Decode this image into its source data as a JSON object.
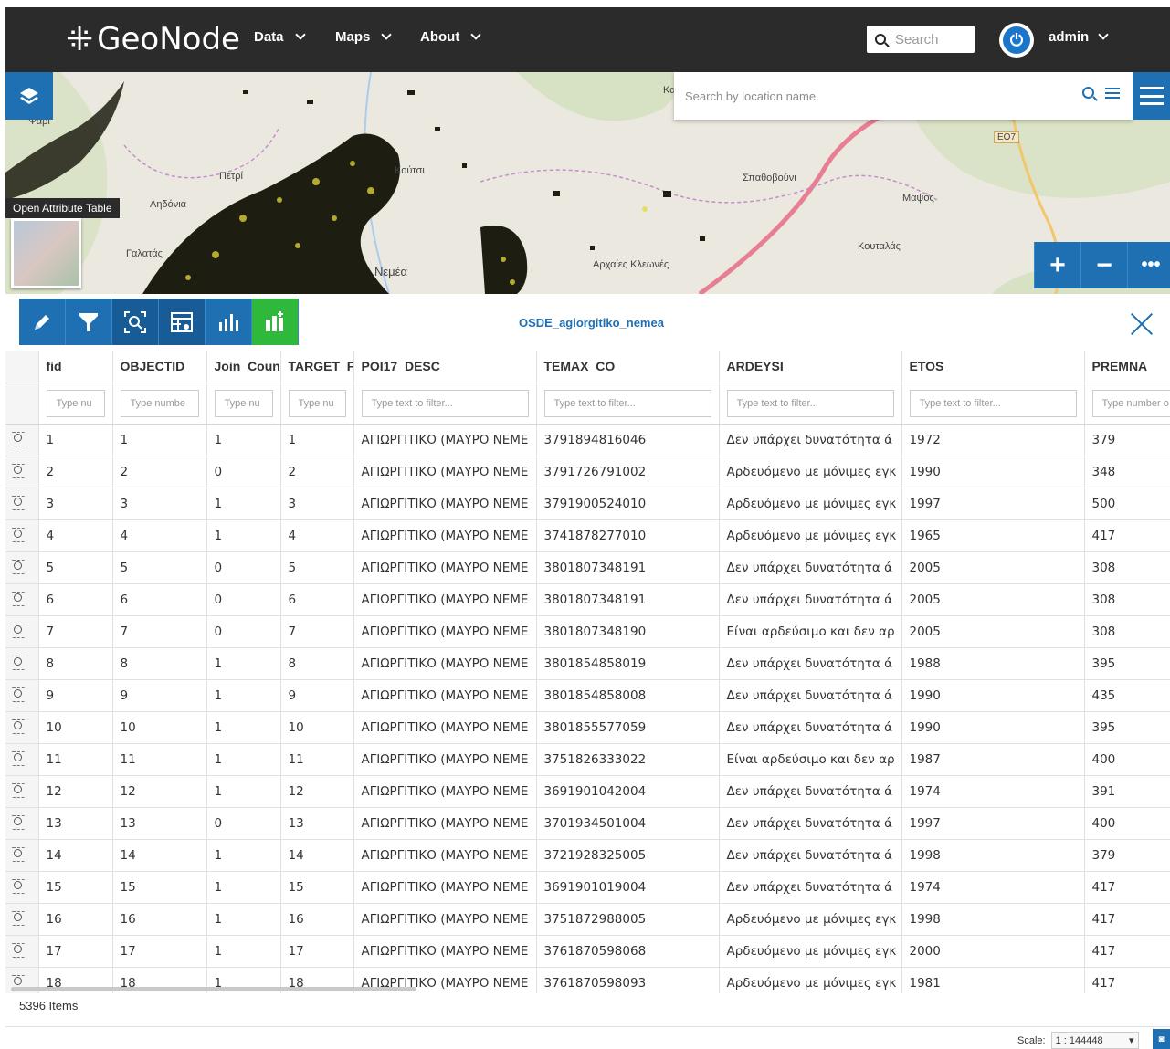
{
  "header": {
    "brand": "GeoNode",
    "nav": [
      "Data",
      "Maps",
      "About"
    ],
    "search_placeholder": "Search",
    "user": "admin"
  },
  "map": {
    "location_placeholder": "Search by location name",
    "tooltip": "Open Attribute Table",
    "labels": [
      "Ψάρι",
      "Αηδόνια",
      "Πετρί",
      "Κούτσι",
      "Γαλατάς",
      "Νεμέα",
      "Αρχαίες Κλεωνές",
      "Σπαθοβούνι",
      "Μαψός",
      "Κουταλάς",
      "ΕΟ7",
      "Κα"
    ]
  },
  "attribute_table": {
    "title": "OSDE_agiorgitiko_nemea",
    "columns": [
      "fid",
      "OBJECTID",
      "Join_Count",
      "TARGET_FI",
      "POI17_DESC",
      "TEMAX_CO",
      "ARDEYSI",
      "ETOS",
      "PREMNA"
    ],
    "filter_placeholders": [
      "Type nu",
      "Type numbe",
      "Type nu",
      "Type nu",
      "Type text to filter...",
      "Type text to filter...",
      "Type text to filter...",
      "Type text to filter...",
      "Type number o"
    ],
    "rows": [
      [
        "1",
        "1",
        "1",
        "1",
        "ΑΓΙΩΡΓΙΤΙΚΟ (ΜΑΥΡΟ ΝΕΜΕ",
        "3791894816046",
        "Δεν υπάρχει δυνατότητα ά",
        "1972",
        "379"
      ],
      [
        "2",
        "2",
        "0",
        "2",
        "ΑΓΙΩΡΓΙΤΙΚΟ (ΜΑΥΡΟ ΝΕΜΕ",
        "3791726791002",
        "Αρδευόμενο με μόνιμες εγκ",
        "1990",
        "348"
      ],
      [
        "3",
        "3",
        "1",
        "3",
        "ΑΓΙΩΡΓΙΤΙΚΟ (ΜΑΥΡΟ ΝΕΜΕ",
        "3791900524010",
        "Αρδευόμενο με μόνιμες εγκ",
        "1997",
        "500"
      ],
      [
        "4",
        "4",
        "1",
        "4",
        "ΑΓΙΩΡΓΙΤΙΚΟ (ΜΑΥΡΟ ΝΕΜΕ",
        "3741878277010",
        "Αρδευόμενο με μόνιμες εγκ",
        "1965",
        "417"
      ],
      [
        "5",
        "5",
        "0",
        "5",
        "ΑΓΙΩΡΓΙΤΙΚΟ (ΜΑΥΡΟ ΝΕΜΕ",
        "3801807348191",
        "Δεν υπάρχει δυνατότητα ά",
        "2005",
        "308"
      ],
      [
        "6",
        "6",
        "0",
        "6",
        "ΑΓΙΩΡΓΙΤΙΚΟ (ΜΑΥΡΟ ΝΕΜΕ",
        "3801807348191",
        "Δεν υπάρχει δυνατότητα ά",
        "2005",
        "308"
      ],
      [
        "7",
        "7",
        "0",
        "7",
        "ΑΓΙΩΡΓΙΤΙΚΟ (ΜΑΥΡΟ ΝΕΜΕ",
        "3801807348190",
        "Είναι αρδεύσιμο και δεν αρ",
        "2005",
        "308"
      ],
      [
        "8",
        "8",
        "1",
        "8",
        "ΑΓΙΩΡΓΙΤΙΚΟ (ΜΑΥΡΟ ΝΕΜΕ",
        "3801854858019",
        "Δεν υπάρχει δυνατότητα ά",
        "1988",
        "395"
      ],
      [
        "9",
        "9",
        "1",
        "9",
        "ΑΓΙΩΡΓΙΤΙΚΟ (ΜΑΥΡΟ ΝΕΜΕ",
        "3801854858008",
        "Δεν υπάρχει δυνατότητα ά",
        "1990",
        "435"
      ],
      [
        "10",
        "10",
        "1",
        "10",
        "ΑΓΙΩΡΓΙΤΙΚΟ (ΜΑΥΡΟ ΝΕΜΕ",
        "3801855577059",
        "Δεν υπάρχει δυνατότητα ά",
        "1990",
        "395"
      ],
      [
        "11",
        "11",
        "1",
        "11",
        "ΑΓΙΩΡΓΙΤΙΚΟ (ΜΑΥΡΟ ΝΕΜΕ",
        "3751826333022",
        "Είναι αρδεύσιμο και δεν αρ",
        "1987",
        "400"
      ],
      [
        "12",
        "12",
        "1",
        "12",
        "ΑΓΙΩΡΓΙΤΙΚΟ (ΜΑΥΡΟ ΝΕΜΕ",
        "3691901042004",
        "Δεν υπάρχει δυνατότητα ά",
        "1974",
        "391"
      ],
      [
        "13",
        "13",
        "0",
        "13",
        "ΑΓΙΩΡΓΙΤΙΚΟ (ΜΑΥΡΟ ΝΕΜΕ",
        "3701934501004",
        "Δεν υπάρχει δυνατότητα ά",
        "1997",
        "400"
      ],
      [
        "14",
        "14",
        "1",
        "14",
        "ΑΓΙΩΡΓΙΤΙΚΟ (ΜΑΥΡΟ ΝΕΜΕ",
        "3721928325005",
        "Δεν υπάρχει δυνατότητα ά",
        "1998",
        "379"
      ],
      [
        "15",
        "15",
        "1",
        "15",
        "ΑΓΙΩΡΓΙΤΙΚΟ (ΜΑΥΡΟ ΝΕΜΕ",
        "3691901019004",
        "Δεν υπάρχει δυνατότητα ά",
        "1974",
        "417"
      ],
      [
        "16",
        "16",
        "1",
        "16",
        "ΑΓΙΩΡΓΙΤΙΚΟ (ΜΑΥΡΟ ΝΕΜΕ",
        "3751872988005",
        "Αρδευόμενο με μόνιμες εγκ",
        "1998",
        "417"
      ],
      [
        "17",
        "17",
        "1",
        "17",
        "ΑΓΙΩΡΓΙΤΙΚΟ (ΜΑΥΡΟ ΝΕΜΕ",
        "3761870598068",
        "Αρδευόμενο με μόνιμες εγκ",
        "2000",
        "417"
      ],
      [
        "18",
        "18",
        "1",
        "18",
        "ΑΓΙΩΡΓΙΤΙΚΟ (ΜΑΥΡΟ ΝΕΜΕ",
        "3761870598093",
        "Αρδευόμενο με μόνιμες εγκ",
        "1981",
        "417"
      ]
    ],
    "item_count": "5396 Items"
  },
  "footer": {
    "scale_label": "Scale:",
    "scale_value": "1 : 144448"
  },
  "colors": {
    "primary": "#1f6fb3",
    "navbar": "#2b2b2b",
    "chart_button": "#2eb83c"
  }
}
